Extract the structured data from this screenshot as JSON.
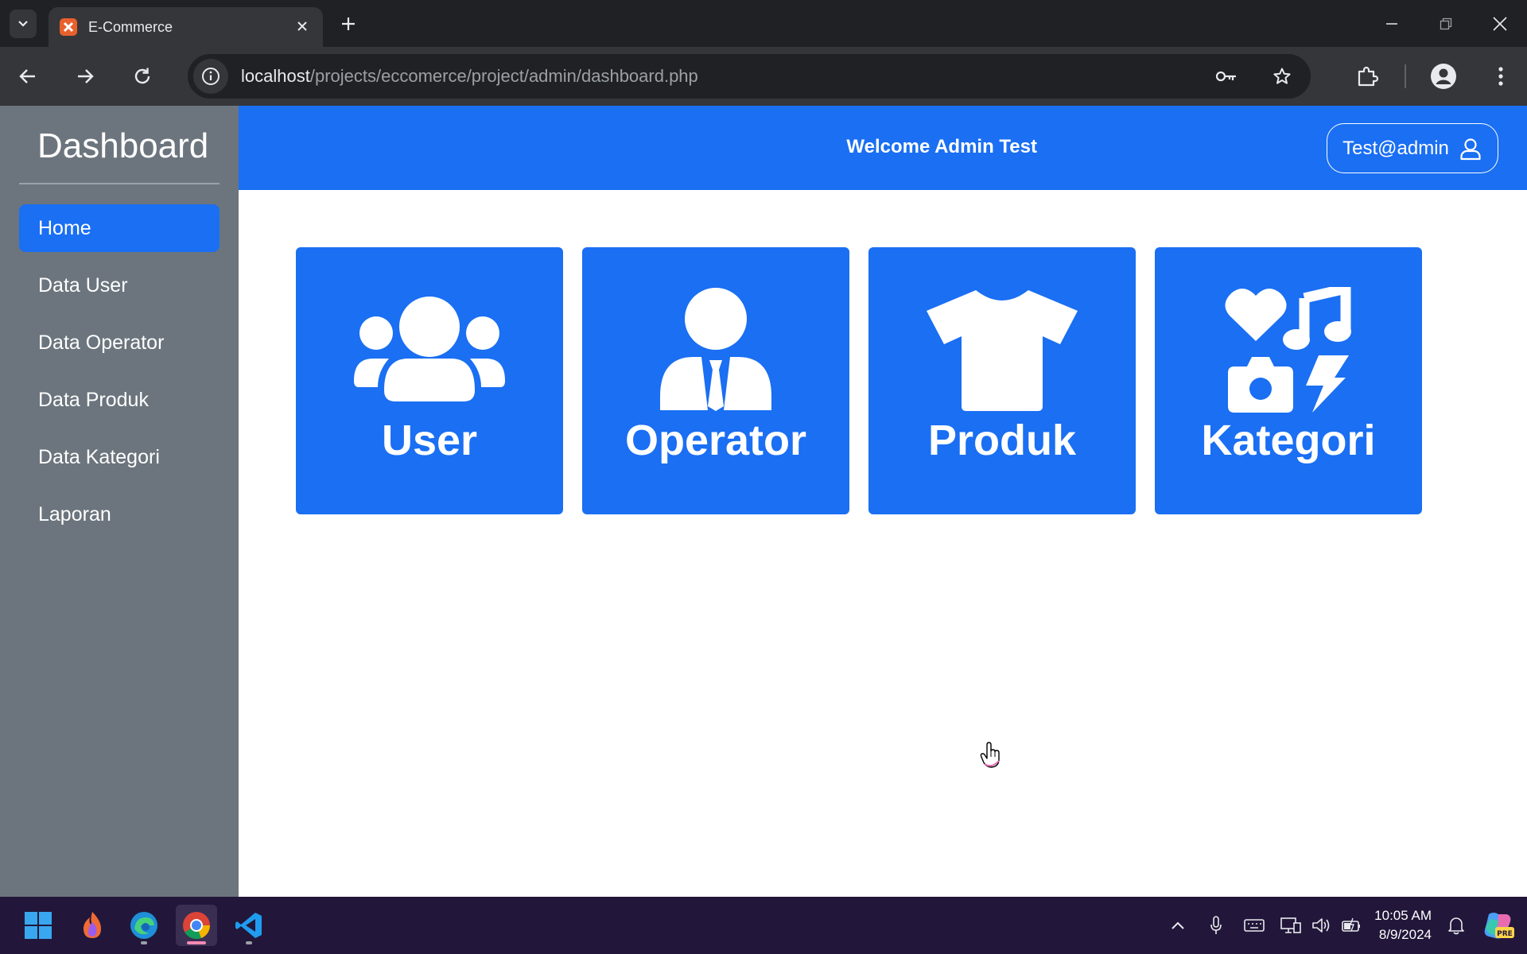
{
  "browser": {
    "tab_title": "E-Commerce",
    "url_host": "localhost",
    "url_path": "/projects/eccomerce/project/admin/dashboard.php"
  },
  "sidebar": {
    "title": "Dashboard",
    "items": [
      {
        "label": "Home",
        "active": true
      },
      {
        "label": "Data User"
      },
      {
        "label": "Data Operator"
      },
      {
        "label": "Data Produk"
      },
      {
        "label": "Data Kategori"
      },
      {
        "label": "Laporan"
      }
    ]
  },
  "header": {
    "welcome": "Welcome Admin Test",
    "user": "Test@admin"
  },
  "cards": [
    {
      "label": "User",
      "icon": "users-icon"
    },
    {
      "label": "Operator",
      "icon": "user-tie-icon"
    },
    {
      "label": "Produk",
      "icon": "shirt-icon"
    },
    {
      "label": "Kategori",
      "icon": "icons-icon"
    }
  ],
  "taskbar": {
    "time": "10:05 AM",
    "date": "8/9/2024"
  },
  "colors": {
    "primary": "#1a6ff3",
    "sidebar": "#6c757d",
    "taskbar": "#22173a"
  }
}
